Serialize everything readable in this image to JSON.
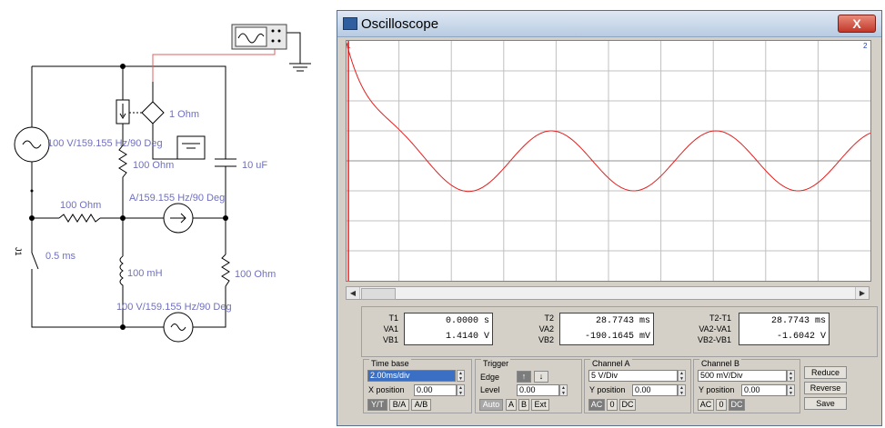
{
  "circuit": {
    "labels": {
      "source1": "100 V/159.155 Hz/90 Deg",
      "res_top": "100 Ohm",
      "ccvs": "1 Ohm",
      "cap": "10 uF",
      "cccs": "A/159.155 Hz/90 Deg",
      "res_mid": "100 Ohm",
      "switch_name": "J1",
      "switch_time": "0.5 ms",
      "inductor": "100 mH",
      "res_right": "100 Ohm",
      "source2": "100 V/159.155 Hz/90 Deg"
    }
  },
  "oscilloscope": {
    "title": "Oscilloscope",
    "close_label": "X",
    "readout": {
      "t1_label": "T1",
      "va1_label": "VA1",
      "vb1_label": "VB1",
      "t1": "0.0000 s",
      "vb1": "1.4140 V",
      "t2_label": "T2",
      "va2_label": "VA2",
      "vb2_label": "VB2",
      "t2": "28.7743 ms",
      "vb2": "-190.1645 mV",
      "dt_label": "T2-T1",
      "dva_label": "VA2-VA1",
      "dvb_label": "VB2-VB1",
      "dt": "28.7743 ms",
      "dvb": "-1.6042 V"
    },
    "timebase": {
      "title": "Time base",
      "value": "2.00ms/div",
      "xpos_label": "X position",
      "xpos": "0.00",
      "btn_yt": "Y/T",
      "btn_ba": "B/A",
      "btn_ab": "A/B"
    },
    "trigger": {
      "title": "Trigger",
      "edge_label": "Edge",
      "level_label": "Level",
      "level": "0.00",
      "btn_auto": "Auto",
      "btn_a": "A",
      "btn_b": "B",
      "btn_ext": "Ext"
    },
    "channel_a": {
      "title": "Channel A",
      "scale": "5 V/Div",
      "ypos_label": "Y position",
      "ypos": "0.00",
      "btn_ac": "AC",
      "btn_0": "0",
      "btn_dc": "DC"
    },
    "channel_b": {
      "title": "Channel B",
      "scale": "500 mV/Div",
      "ypos_label": "Y position",
      "ypos": "0.00",
      "btn_ac": "AC",
      "btn_0": "0",
      "btn_dc": "DC"
    },
    "buttons": {
      "reduce": "Reduce",
      "reverse": "Reverse",
      "save": "Save"
    },
    "cursor1": "1",
    "cursor2": "2",
    "trace_color": "#e02020",
    "trace": {
      "description": "damped transient then sinusoid, channel B, 2.00 ms/div",
      "period_ms": 6.28,
      "steady_amplitude_div": 1.0
    }
  },
  "colors": {
    "wire": "#000000",
    "probe_wire": "#e06060",
    "label": "#7070c0",
    "grid": "#c0c0c0"
  }
}
